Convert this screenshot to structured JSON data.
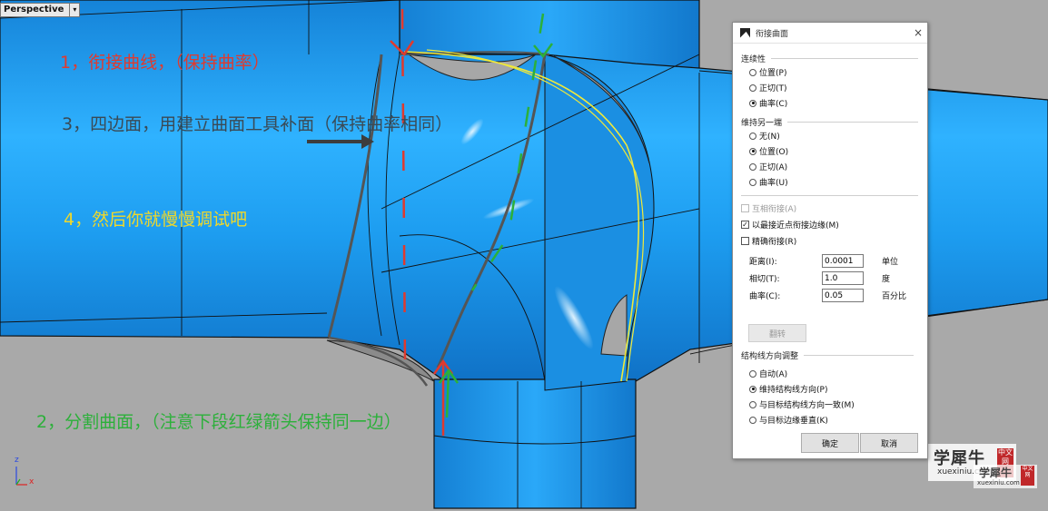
{
  "viewport": {
    "name": "Perspective",
    "menu_arrow": "▾",
    "axes": {
      "x": "x",
      "z": "z"
    }
  },
  "annotations": {
    "step1": "1，衔接曲线，（保持曲率）",
    "step3": "3，四边面，用建立曲面工具补面（保持曲率相同）",
    "step4": "4，然后你就慢慢调试吧",
    "step2": "2，分割曲面，（注意下段红绿箭头保持同一边）"
  },
  "dialog": {
    "title": "衔接曲面",
    "close": "×",
    "continuity": {
      "label": "连续性",
      "options": [
        "位置(P)",
        "正切(T)",
        "曲率(C)"
      ],
      "selected": 2
    },
    "maintain_other_end": {
      "label": "维持另一端",
      "options": [
        "无(N)",
        "位置(O)",
        "正切(A)",
        "曲率(U)"
      ],
      "selected": 1
    },
    "checks": {
      "mutual": "互相衔接(A)",
      "closest_point": "以最接近点衔接边缘(M)",
      "precise": "精确衔接(R)",
      "checked_mark": "✓"
    },
    "tolerances": {
      "distance_label": "距离(I):",
      "distance": "0.0001",
      "distance_unit": "单位",
      "tangent_label": "相切(T):",
      "tangent": "1.0",
      "tangent_unit": "度",
      "curvature_label": "曲率(C):",
      "curvature": "0.05",
      "curvature_unit": "百分比"
    },
    "flip": "翻转",
    "isocurve": {
      "label": "结构线方向调整",
      "options": [
        "自动(A)",
        "维持结构线方向(P)",
        "与目标结构线方向一致(M)",
        "与目标边缘垂直(K)"
      ],
      "selected": 1
    },
    "ok": "确定",
    "cancel": "取消"
  },
  "watermark": {
    "brand": "学犀牛",
    "url": "xuexiniu.com",
    "seal": "中文网"
  },
  "colors": {
    "surface": "#1f95e6",
    "background": "#a9a9a9",
    "red": "#e03a2e",
    "green": "#2cb03a",
    "yellow": "#f0d82a"
  }
}
